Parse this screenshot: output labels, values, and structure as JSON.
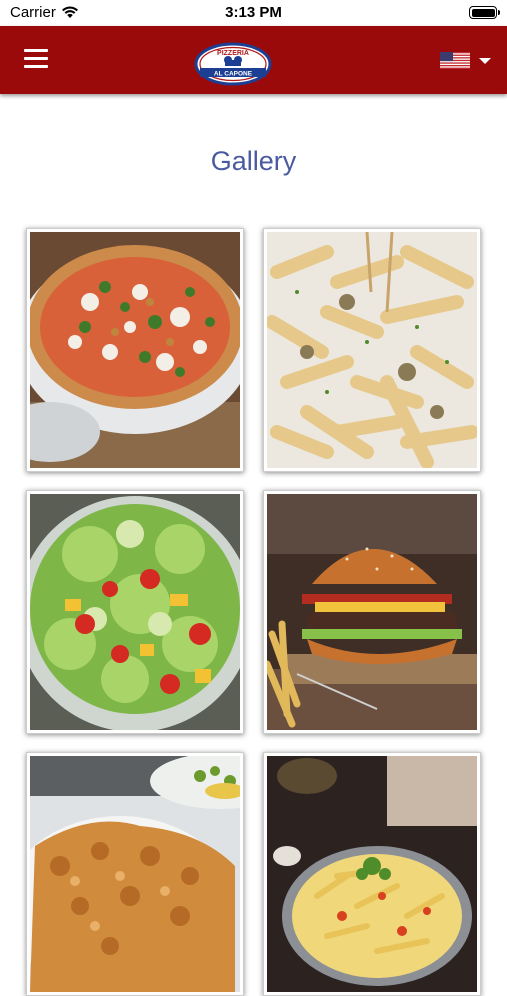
{
  "status_bar": {
    "carrier": "Carrier",
    "time": "3:13 PM"
  },
  "header": {
    "logo_text_top": "PIZZERIA",
    "logo_text_bottom": "AL CAPONE",
    "menu_icon": "hamburger-menu-icon",
    "language_icon": "us-flag-icon",
    "dropdown_icon": "chevron-down-icon"
  },
  "page": {
    "title": "Gallery"
  },
  "gallery": [
    {
      "name": "pizza"
    },
    {
      "name": "penne-pasta"
    },
    {
      "name": "salad"
    },
    {
      "name": "burger"
    },
    {
      "name": "schnitzel"
    },
    {
      "name": "pasta-bowl"
    }
  ],
  "colors": {
    "header_bg": "#9a0a0a",
    "title": "#4a5aa0",
    "logo_blue": "#1d3f93",
    "logo_red": "#b11a1a"
  }
}
